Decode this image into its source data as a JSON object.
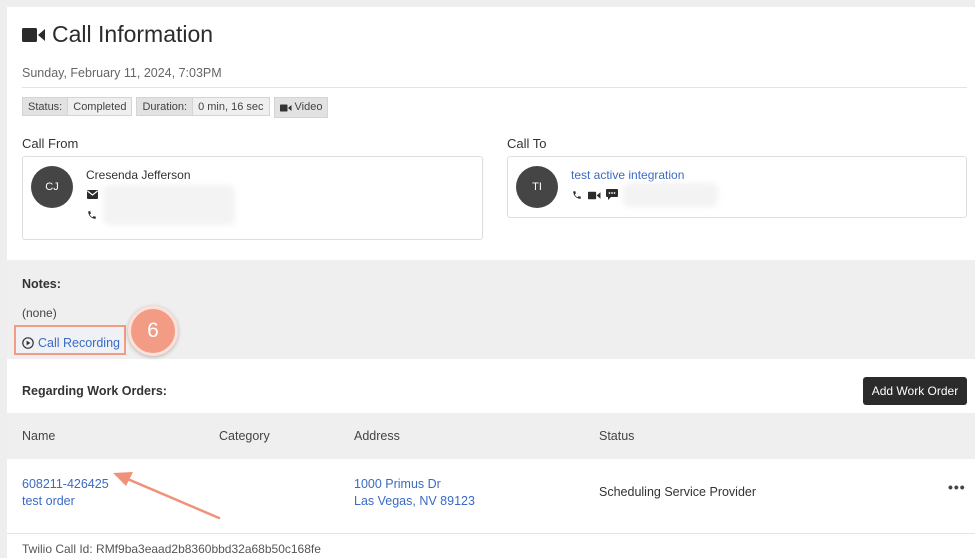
{
  "header": {
    "title": "Call Information",
    "datetime": "Sunday, February 11, 2024, 7:03PM"
  },
  "badges": {
    "status_label": "Status:",
    "status_value": "Completed",
    "duration_label": "Duration:",
    "duration_value": "0 min, 16 sec",
    "type_label": "Video"
  },
  "call_from": {
    "label": "Call From",
    "initials": "CJ",
    "name": "Cresenda Jefferson"
  },
  "call_to": {
    "label": "Call To",
    "initials": "TI",
    "name": "test active integration"
  },
  "notes": {
    "label": "Notes:",
    "value": "(none)",
    "recording_link": "Call Recording",
    "step_number": "6"
  },
  "work_orders": {
    "title": "Regarding Work Orders:",
    "add_button": "Add Work Order",
    "columns": [
      "Name",
      "Category",
      "Address",
      "Status"
    ],
    "rows": [
      {
        "id": "608211-426425",
        "name": "test order",
        "category": "",
        "address_line1": "1000 Primus Dr",
        "address_line2": "Las Vegas, NV 89123",
        "status": "Scheduling Service Provider",
        "menu": "•••"
      }
    ]
  },
  "footer": {
    "call_id": "Twilio Call Id: RMf9ba3eaad2b8360bbd32a68b50c168fe"
  },
  "colors": {
    "link": "#3a6bc4",
    "highlight": "#f29b85",
    "button_dark": "#2b2b2b",
    "section_gray": "#efefef"
  },
  "icons": [
    "video-icon",
    "envelope-icon",
    "phone-icon",
    "chat-icon",
    "play-circle-icon",
    "ellipsis-icon"
  ]
}
